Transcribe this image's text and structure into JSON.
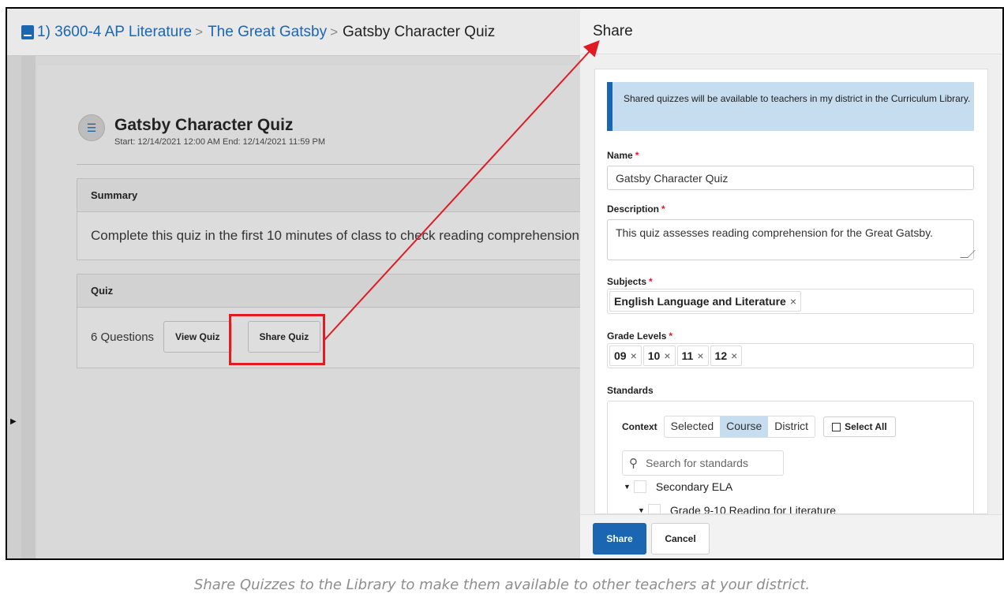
{
  "breadcrumb": {
    "course": "1) 3600-4 AP Literature",
    "unit": "The Great Gatsby",
    "current": "Gatsby Character Quiz",
    "separator": ">"
  },
  "quiz": {
    "title": "Gatsby Character Quiz",
    "dates": "Start: 12/14/2021 12:00 AM  End: 12/14/2021 11:59 PM",
    "icon": "list-icon"
  },
  "summary": {
    "heading": "Summary",
    "text": "Complete this quiz in the first 10 minutes of class to check reading comprehension."
  },
  "quiz_panel": {
    "heading": "Quiz",
    "questions": "6 Questions",
    "view_label": "View Quiz",
    "share_label": "Share Quiz"
  },
  "share": {
    "title": "Share",
    "info": "Shared quizzes will be available to teachers in my district in the Curriculum Library.",
    "name_label": "Name",
    "name_value": "Gatsby Character Quiz",
    "description_label": "Description",
    "description_value": "This quiz assesses reading comprehension for the Great Gatsby.",
    "subjects_label": "Subjects",
    "subjects": [
      "English Language and Literature"
    ],
    "grades_label": "Grade Levels",
    "grades": [
      "09",
      "10",
      "11",
      "12"
    ],
    "standards_label": "Standards",
    "context_label": "Context",
    "context_options": [
      "Selected",
      "Course",
      "District"
    ],
    "context_selected": "Course",
    "select_all_label": "Select All",
    "search_placeholder": "Search for standards",
    "tree": [
      "Secondary ELA",
      "Grade 9-10 Reading for Literature"
    ],
    "required_mark": "*",
    "remove_mark": "×"
  },
  "footer": {
    "share_label": "Share",
    "cancel_label": "Cancel"
  },
  "caption": "Share Quizzes to the Library to make them available to other teachers at your district.",
  "colors": {
    "accent": "#1a66b3",
    "annotation": "#e11b22",
    "info_bg": "#c6dcef"
  }
}
